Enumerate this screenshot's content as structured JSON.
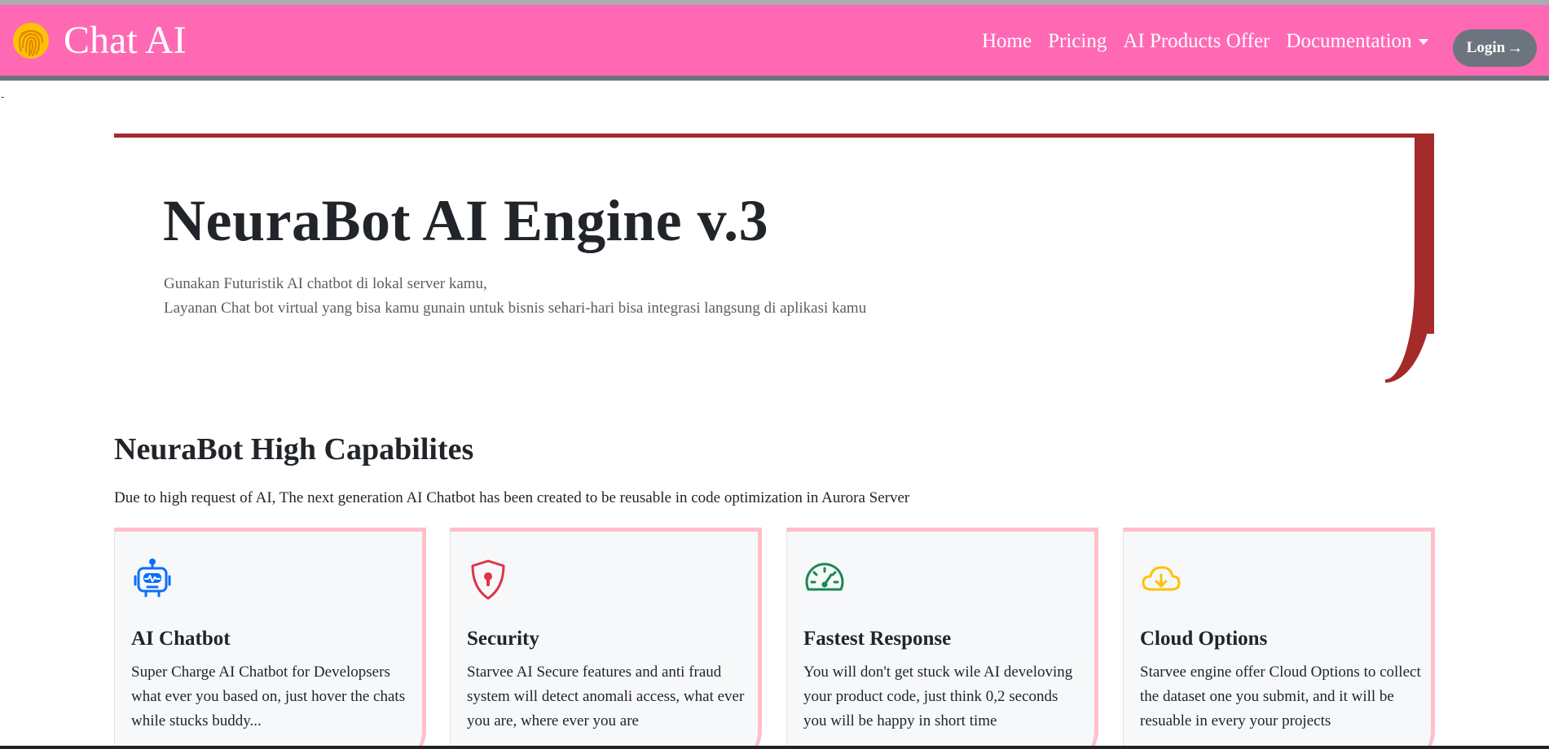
{
  "brand": {
    "name": "Chat AI",
    "icon": "fingerprint-icon"
  },
  "nav": {
    "items": [
      {
        "label": "Home"
      },
      {
        "label": "Pricing"
      },
      {
        "label": "AI Products Offer"
      },
      {
        "label": "Documentation"
      }
    ],
    "login_label": "Login",
    "login_icon": "arrow-right-icon"
  },
  "dash_text": "-",
  "hero": {
    "title": "NeuraBot AI Engine v.3",
    "subtitle_line1": "Gunakan Futuristik AI chatbot di lokal server kamu,",
    "subtitle_line2": "Layanan Chat bot virtual yang bisa kamu gunain untuk bisnis sehari-hari bisa integrasi langsung di aplikasi kamu"
  },
  "capabilities": {
    "title": "NeuraBot High Capabilites",
    "description": "Due to high request of AI, The next generation AI Chatbot has been created to be reusable in code optimization in Aurora Server",
    "cards": [
      {
        "icon": "robot-icon",
        "color": "#0d6efd",
        "title": "AI Chatbot",
        "text": "Super Charge AI Chatbot for Developsers what ever you based on, just hover the chats while stucks buddy..."
      },
      {
        "icon": "shield-lock-icon",
        "color": "#dc3545",
        "title": "Security",
        "text": "Starvee AI Secure features and anti fraud system will detect anomali access, what ever you are, where ever you are"
      },
      {
        "icon": "speedometer-icon",
        "color": "#198754",
        "title": "Fastest Response",
        "text": "You will don't get stuck wile AI develoving your product code, just think 0,2 seconds you will be happy in short time"
      },
      {
        "icon": "cloud-download-icon",
        "color": "#ffc107",
        "title": "Cloud Options",
        "text": "Starvee engine offer Cloud Options to collect the dataset one you submit, and it will be resuable in every your projects"
      }
    ]
  },
  "colors": {
    "navbar": "#ff69b4",
    "accent": "#a52a2a",
    "card_border": "#ffc0cb",
    "login_bg": "#6c757d"
  }
}
